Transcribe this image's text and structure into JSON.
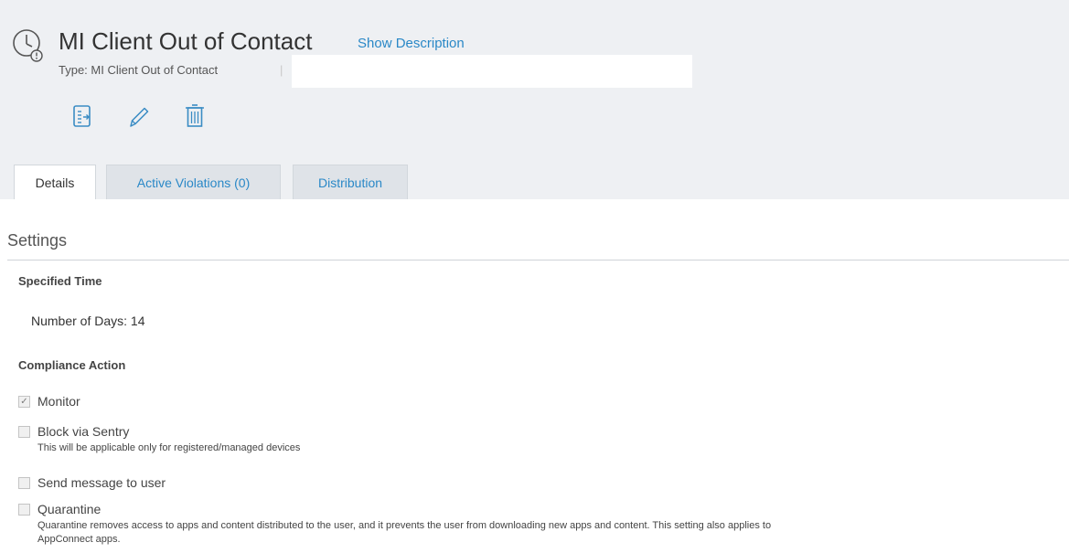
{
  "header": {
    "title": "MI Client Out of Contact",
    "show_description": "Show Description",
    "type_label": "Type: MI Client Out of Contact",
    "type_separator": "|",
    "type_input_value": "",
    "type_input_placeholder": "",
    "actions": [
      {
        "name": "copy-policy",
        "icon": "document-copy-icon"
      },
      {
        "name": "edit",
        "icon": "pencil-icon"
      },
      {
        "name": "delete",
        "icon": "trash-icon"
      }
    ]
  },
  "tabs": [
    {
      "label": "Details",
      "active": true
    },
    {
      "label": "Active Violations (0)",
      "active": false
    },
    {
      "label": "Distribution",
      "active": false
    }
  ],
  "settings": {
    "title": "Settings",
    "specified_time": {
      "label": "Specified Time",
      "days_text": "Number of Days: 14"
    },
    "compliance": {
      "label": "Compliance Action",
      "options": [
        {
          "label": "Monitor",
          "checked": true,
          "note": ""
        },
        {
          "label": "Block via Sentry",
          "checked": false,
          "note": "This will be applicable only for registered/managed devices"
        },
        {
          "label": "Send message to user",
          "checked": false,
          "note": ""
        },
        {
          "label": "Quarantine",
          "checked": false,
          "note": "Quarantine removes access to apps and content distributed to the user, and it prevents the user from downloading new apps and content. This setting also applies to",
          "note_line2": "AppConnect apps."
        }
      ]
    }
  },
  "colors": {
    "header_bg": "#eef0f3",
    "accent": "#2a88c7",
    "icon": "#3a8cc4"
  }
}
